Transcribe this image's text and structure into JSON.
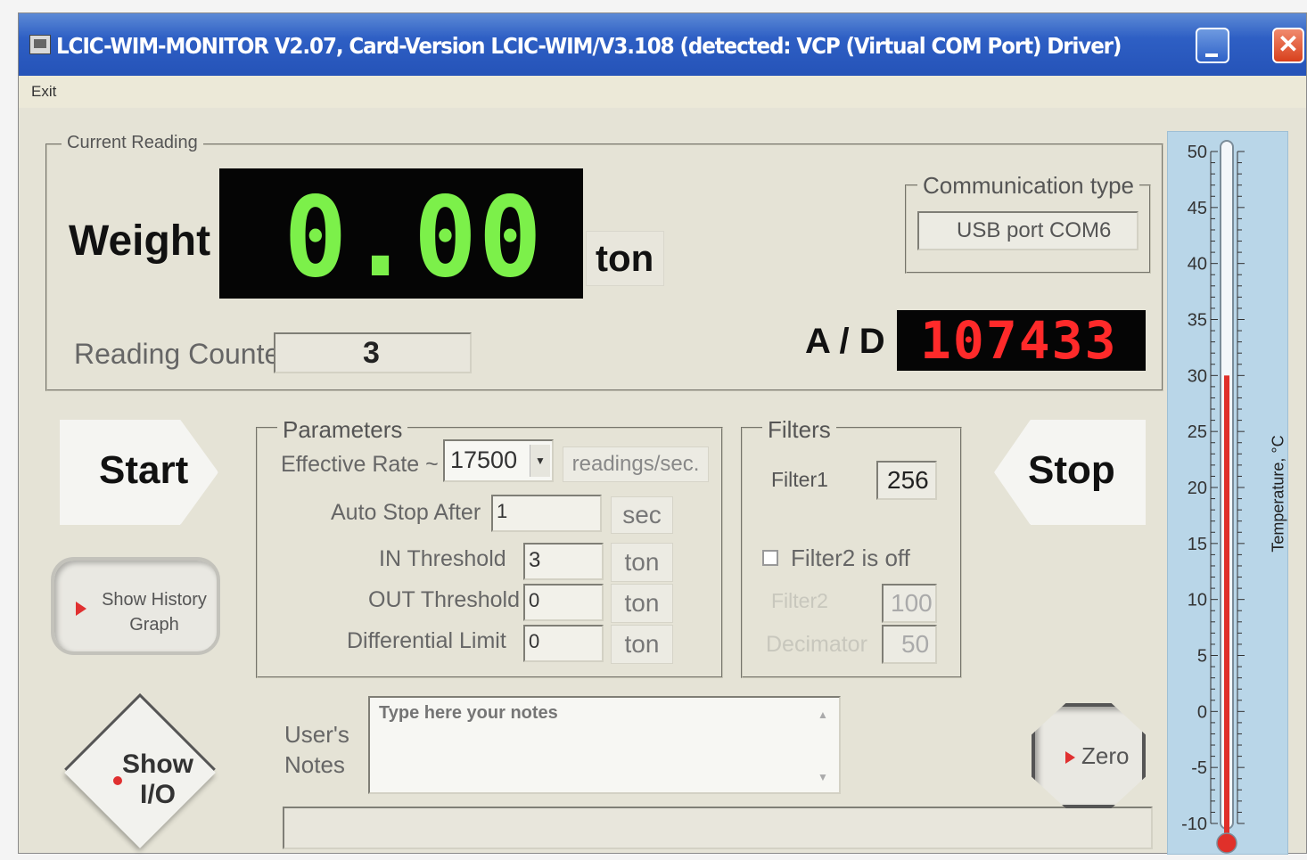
{
  "window": {
    "title": "LCIC-WIM-MONITOR V2.07, Card-Version LCIC-WIM/V3.108 (detected: VCP (Virtual COM Port) Driver)"
  },
  "menu": {
    "exit": "Exit"
  },
  "current_reading": {
    "legend": "Current Reading",
    "weight_label": "Weight",
    "weight_value": "0.00",
    "weight_unit": "ton",
    "reading_counter_label": "Reading Counter",
    "reading_counter_value": "3"
  },
  "communication": {
    "legend": "Communication type",
    "value": "USB port COM6"
  },
  "ad": {
    "label": "A / D",
    "value": "107433"
  },
  "buttons": {
    "start": "Start",
    "stop": "Stop",
    "show_history": "Show History Graph",
    "show_io": "Show I/O",
    "zero": "Zero"
  },
  "parameters": {
    "legend": "Parameters",
    "effective_rate_label": "Effective Rate ~",
    "effective_rate_value": "17500",
    "effective_rate_unit": "readings/sec.",
    "auto_stop_label": "Auto Stop After",
    "auto_stop_value": "1",
    "auto_stop_unit": "sec",
    "in_threshold_label": "IN Threshold",
    "in_threshold_value": "3",
    "in_threshold_unit": "ton",
    "out_threshold_label": "OUT Threshold",
    "out_threshold_value": "0",
    "out_threshold_unit": "ton",
    "differential_label": "Differential Limit",
    "differential_value": "0",
    "differential_unit": "ton"
  },
  "filters": {
    "legend": "Filters",
    "filter1_label": "Filter1",
    "filter1_value": "256",
    "filter2_checkbox_label": "Filter2 is off",
    "filter2_checked": false,
    "filter2_label": "Filter2",
    "filter2_value": "100",
    "decimator_label": "Decimator",
    "decimator_value": "50"
  },
  "notes": {
    "label": "User's Notes",
    "placeholder": "Type here your notes"
  },
  "status_bar": {
    "text": ""
  },
  "thermometer": {
    "axis_label": "Temperature, °C",
    "ticks": [
      "50",
      "45",
      "40",
      "35",
      "30",
      "25",
      "20",
      "15",
      "10",
      "5",
      "0",
      "-5",
      "-10"
    ],
    "min": -10,
    "max": 50,
    "current_value": 30,
    "fill_color": "#e0302a"
  },
  "colors": {
    "titlebar": "#2553b8",
    "lcd_green": "#7cf04a",
    "lcd_red": "#ff2a2a",
    "window_bg": "#e5e3d6"
  }
}
